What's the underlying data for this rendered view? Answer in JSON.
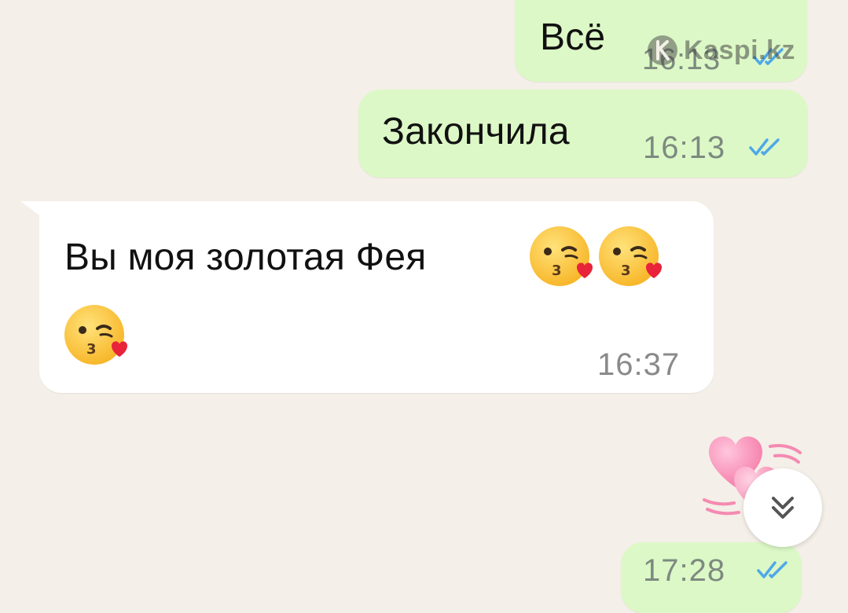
{
  "messages": [
    {
      "direction": "out",
      "text": "Всё",
      "time": "16:13",
      "status": "read"
    },
    {
      "direction": "out",
      "text": "Закончила",
      "time": "16:13",
      "status": "read"
    },
    {
      "direction": "in",
      "text": "Вы моя золотая Фея",
      "emoji": [
        "kissing-heart-emoji",
        "kissing-heart-emoji",
        "kissing-heart-emoji"
      ],
      "time": "16:37"
    },
    {
      "direction": "out",
      "sticker": "pink-hearts-sticker"
    },
    {
      "direction": "out",
      "text": "",
      "time": "17:28",
      "status": "read"
    }
  ],
  "watermark": {
    "text": "Kaspi.kz",
    "icon": "kaspi-logo-icon"
  },
  "scroll_button": {
    "icon": "double-chevron-down-icon"
  },
  "colors": {
    "background": "#f4efe8",
    "outgoing_bubble": "#dcf8c6",
    "incoming_bubble": "#ffffff",
    "read_ticks": "#4fa8e8",
    "time_text": "#7d8a80"
  }
}
